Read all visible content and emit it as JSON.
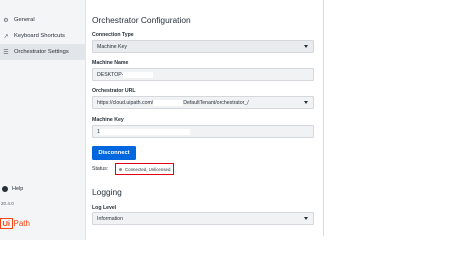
{
  "sidebar": {
    "items": [
      {
        "label": "General",
        "icon": "settings-gear-icon"
      },
      {
        "label": "Keyboard Shortcuts",
        "icon": "arrow-icon"
      },
      {
        "label": "Orchestrator Settings",
        "icon": "sliders-icon"
      }
    ],
    "help_label": "Help",
    "version": "20.4.0",
    "logo": {
      "ui": "Ui",
      "path": "Path",
      "color": "#fa4616"
    }
  },
  "main": {
    "title": "Orchestrator Configuration",
    "connection_type": {
      "label": "Connection Type",
      "value": "Machine Key"
    },
    "machine_name": {
      "label": "Machine Name",
      "value": "DESKTOP-"
    },
    "orchestrator_url": {
      "label": "Orchestrator URL",
      "value_prefix": "https://cloud.uipath.com/",
      "value_suffix": "DefaultTenant/orchestrator_/"
    },
    "machine_key": {
      "label": "Machine Key",
      "value": "1"
    },
    "disconnect_button": "Disconnect",
    "status": {
      "label": "Status:",
      "value": "Connected, Unlicensed",
      "highlight_color": "#e0001a"
    },
    "logging": {
      "title": "Logging",
      "log_level_label": "Log Level",
      "log_level_value": "Information"
    }
  },
  "colors": {
    "primary_button": "#0067df",
    "sidebar_bg": "#f4f5f7"
  }
}
